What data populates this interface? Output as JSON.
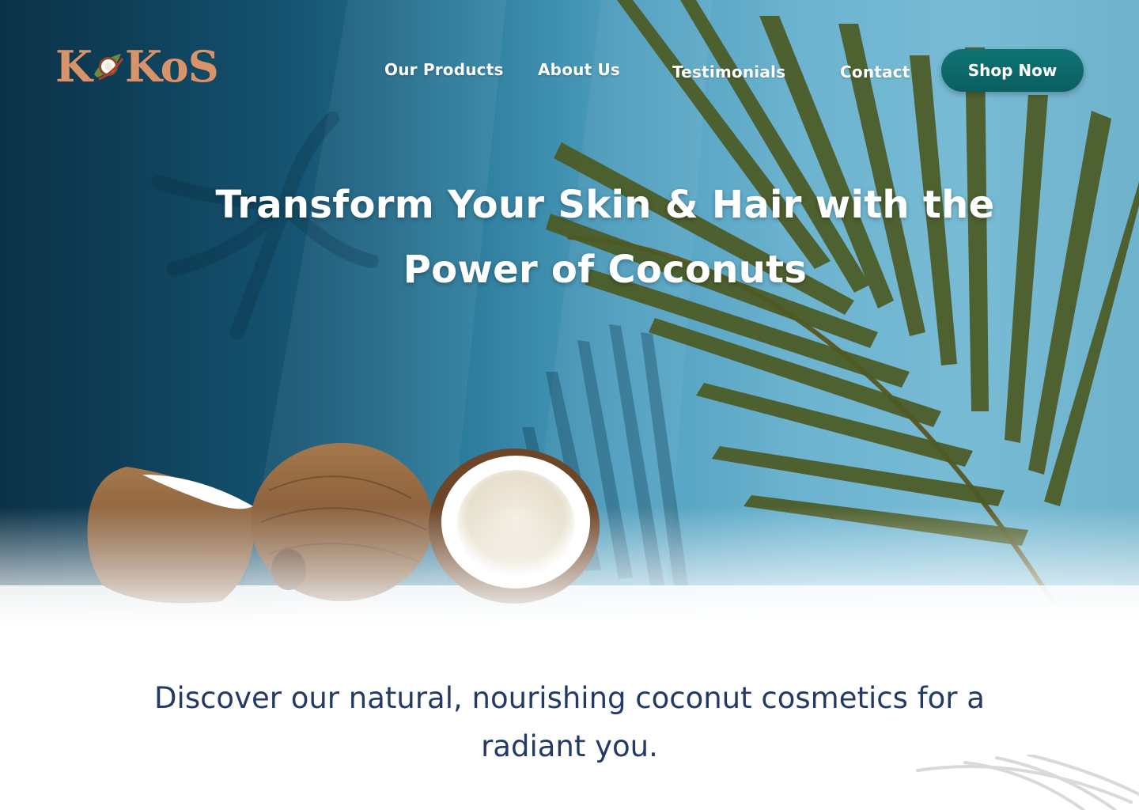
{
  "brand": {
    "logo_text_left": "K",
    "logo_text_right": "KoS",
    "logo_color": "#d8936a"
  },
  "nav": {
    "items": [
      {
        "label": "Our Products"
      },
      {
        "label": "About Us"
      },
      {
        "label": "Testimonials"
      },
      {
        "label": "Contact"
      }
    ],
    "cta_label": "Shop Now",
    "cta_color": "#0f7474"
  },
  "hero": {
    "headline_line1": "Transform Your Skin & Hair with the",
    "headline_line2": "Power of Coconuts"
  },
  "intro": {
    "line1": "Discover our natural, nourishing coconut cosmetics for a",
    "line2": "radiant you.",
    "color": "#243a66"
  },
  "icons": {
    "logo_mark": "coconut-leaf-icon"
  }
}
